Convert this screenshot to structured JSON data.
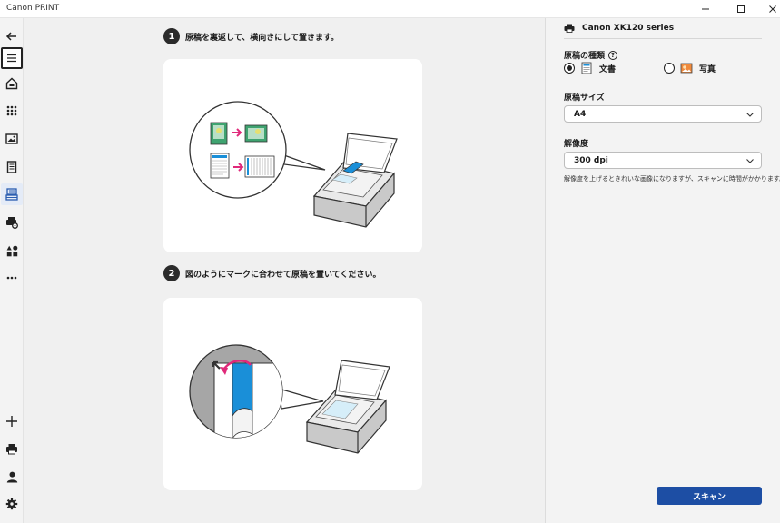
{
  "window": {
    "title": "Canon PRINT"
  },
  "main": {
    "step1": {
      "number": "1",
      "text": "原稿を裏返して、横向きにして置きます。"
    },
    "step2": {
      "number": "2",
      "text": "図のようにマークに合わせて原稿を置いてください。"
    }
  },
  "panel": {
    "device_name": "Canon XK120 series",
    "doc_type_label": "原稿の種類",
    "help_icon": "?",
    "doc_options": [
      {
        "label": "文書",
        "selected": true
      },
      {
        "label": "写真",
        "selected": false
      }
    ],
    "size_label": "原稿サイズ",
    "size_value": "A4",
    "resolution_label": "解像度",
    "resolution_value": "300 dpi",
    "resolution_note": "解像度を上げるときれいな画像になりますが、スキャンに時間がかかります。",
    "scan_button": "スキャン"
  },
  "colors": {
    "accent": "#1d4ea4",
    "highlight": "#e0297a",
    "scanner_blue": "#1a8fd8"
  }
}
